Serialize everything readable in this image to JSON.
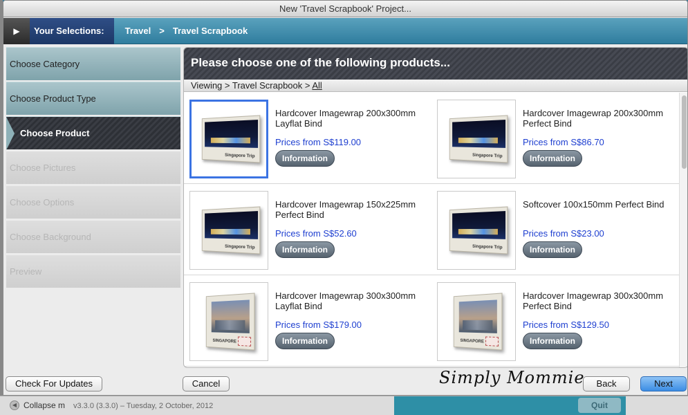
{
  "window": {
    "title": "New 'Travel Scrapbook' Project..."
  },
  "selections": {
    "label": "Your Selections:",
    "crumbs": [
      "Travel",
      ">",
      "Travel Scrapbook"
    ]
  },
  "steps": [
    {
      "label": "Choose Category",
      "state": "done"
    },
    {
      "label": "Choose Product Type",
      "state": "done"
    },
    {
      "label": "Choose Product",
      "state": "active"
    },
    {
      "label": "Choose Pictures",
      "state": "disabled"
    },
    {
      "label": "Choose Options",
      "state": "disabled"
    },
    {
      "label": "Choose Background",
      "state": "disabled"
    },
    {
      "label": "Preview",
      "state": "disabled"
    }
  ],
  "panel": {
    "heading": "Please choose one of the following products...",
    "viewing_prefix": "Viewing > Travel Scrapbook > ",
    "viewing_link": "All",
    "info_label": "Information",
    "products": [
      {
        "name": "Hardcover Imagewrap 200x300mm Layflat Bind",
        "price": "Prices from S$119.00",
        "thumb_caption": "Singapore Trip",
        "selected": true
      },
      {
        "name": "Hardcover Imagewrap 200x300mm Perfect Bind",
        "price": "Prices from S$86.70",
        "thumb_caption": "Singapore Trip",
        "selected": false
      },
      {
        "name": "Hardcover Imagewrap 150x225mm Perfect Bind",
        "price": "Prices from S$52.60",
        "thumb_caption": "Singapore Trip",
        "selected": false
      },
      {
        "name": "Softcover 100x150mm Perfect Bind",
        "price": "Prices from S$23.00",
        "thumb_caption": "Singapore Trip",
        "selected": false
      },
      {
        "name": "Hardcover Imagewrap 300x300mm Layflat Bind",
        "price": "Prices from S$179.00",
        "thumb_caption": "SINGAPORE",
        "selected": false
      },
      {
        "name": "Hardcover Imagewrap 300x300mm Perfect Bind",
        "price": "Prices from S$129.50",
        "thumb_caption": "SINGAPORE",
        "selected": false
      }
    ]
  },
  "footer": {
    "check_updates": "Check For Updates",
    "cancel": "Cancel",
    "back": "Back",
    "next": "Next",
    "watermark": "Simply Mommie"
  },
  "background_app": {
    "collapse": "Collapse m",
    "version": "v3.3.0 (3.3.0) – Tuesday, 2 October, 2012",
    "quit": "Quit"
  },
  "colors": {
    "accent": "#3b73e3",
    "price": "#1e3fd0",
    "primary_button": "#3c8de4"
  }
}
